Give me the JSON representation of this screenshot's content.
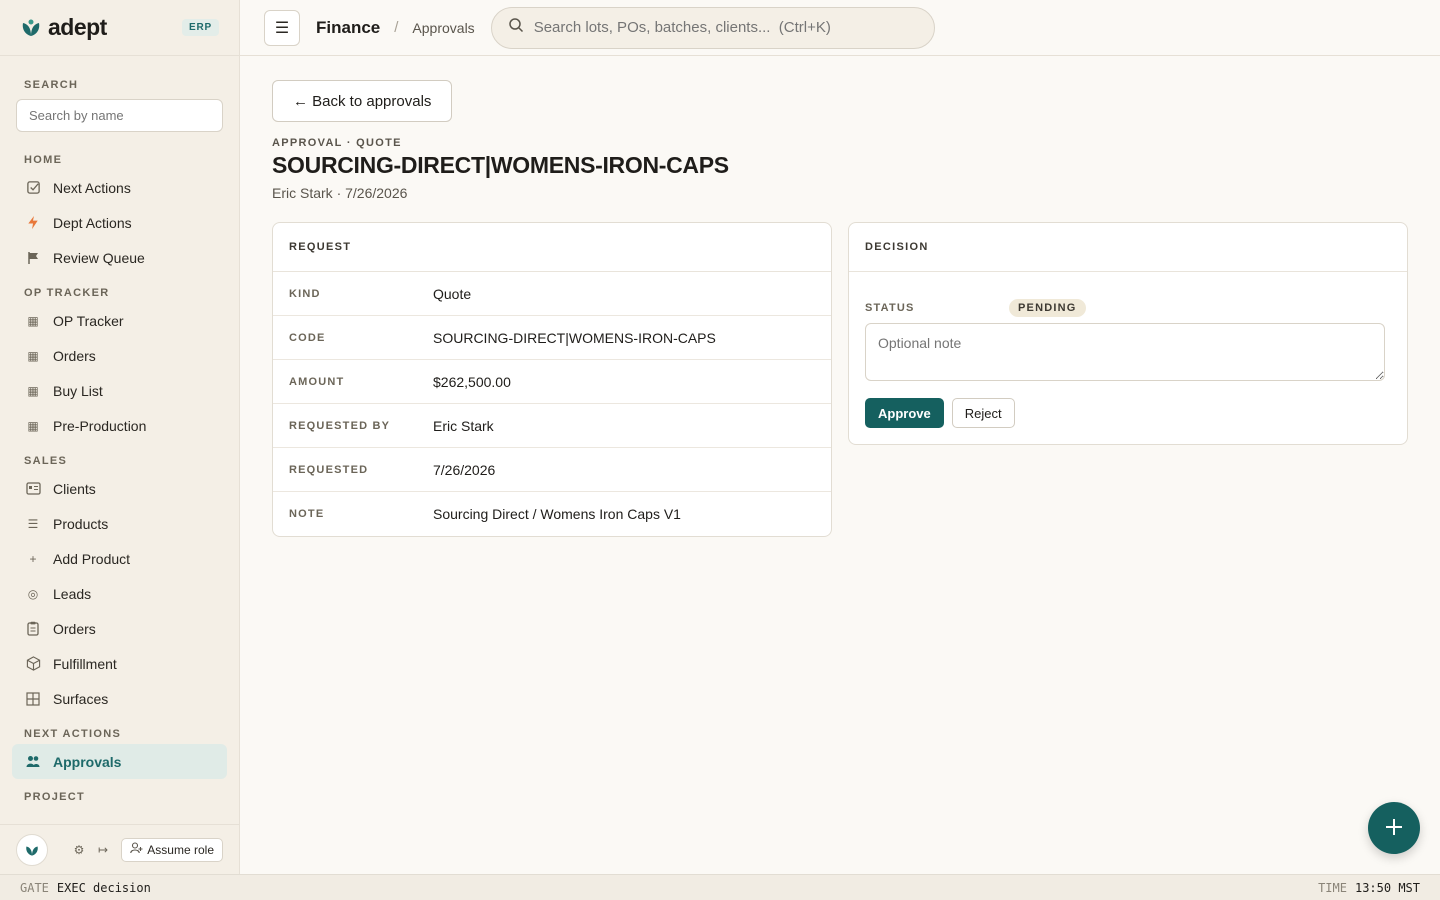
{
  "brand": {
    "name": "adept",
    "badge": "ERP"
  },
  "sidebar": {
    "search_label": "SEARCH",
    "search_placeholder": "Search by name",
    "groups": [
      {
        "label": "HOME",
        "items": [
          {
            "label": "Next Actions",
            "icon": "check-square-icon"
          },
          {
            "label": "Dept Actions",
            "icon": "bolt-icon"
          },
          {
            "label": "Review Queue",
            "icon": "flag-icon"
          }
        ]
      },
      {
        "label": "OP TRACKER",
        "items": [
          {
            "label": "OP Tracker",
            "icon": "grid-icon"
          },
          {
            "label": "Orders",
            "icon": "grid-icon"
          },
          {
            "label": "Buy List",
            "icon": "grid-icon"
          },
          {
            "label": "Pre-Production",
            "icon": "grid-icon"
          }
        ]
      },
      {
        "label": "SALES",
        "items": [
          {
            "label": "Clients",
            "icon": "id-card-icon"
          },
          {
            "label": "Products",
            "icon": "list-icon"
          },
          {
            "label": "Add Product",
            "icon": "plus-icon"
          },
          {
            "label": "Leads",
            "icon": "target-icon"
          },
          {
            "label": "Orders",
            "icon": "clipboard-icon"
          },
          {
            "label": "Fulfillment",
            "icon": "box-icon"
          },
          {
            "label": "Surfaces",
            "icon": "table-icon"
          }
        ]
      },
      {
        "label": "NEXT ACTIONS",
        "items": [
          {
            "label": "Approvals",
            "icon": "users-icon",
            "active": true
          }
        ]
      },
      {
        "label": "PROJECT",
        "items": []
      }
    ],
    "footer": {
      "assume_role": "Assume role"
    }
  },
  "topbar": {
    "breadcrumb_root": "Finance",
    "breadcrumb_sep": "/",
    "breadcrumb_page": "Approvals",
    "search_placeholder": "Search lots, POs, batches, clients...  (Ctrl+K)"
  },
  "page": {
    "back_label": "← Back to approvals",
    "eyebrow": "APPROVAL · QUOTE",
    "title": "SOURCING-DIRECT|WOMENS-IRON-CAPS",
    "subtitle": "Eric Stark · 7/26/2026"
  },
  "request": {
    "heading": "REQUEST",
    "rows": [
      {
        "key": "KIND",
        "value": "Quote"
      },
      {
        "key": "CODE",
        "value": "SOURCING-DIRECT|WOMENS-IRON-CAPS"
      },
      {
        "key": "AMOUNT",
        "value": "$262,500.00"
      },
      {
        "key": "REQUESTED BY",
        "value": "Eric Stark"
      },
      {
        "key": "REQUESTED",
        "value": "7/26/2026"
      },
      {
        "key": "NOTE",
        "value": "Sourcing Direct / Womens Iron Caps V1"
      }
    ]
  },
  "decision": {
    "heading": "DECISION",
    "status_key": "STATUS",
    "status_value": "PENDING",
    "note_placeholder": "Optional note",
    "approve_label": "Approve",
    "reject_label": "Reject"
  },
  "statusbar": {
    "gate_key": "GATE",
    "gate_value": "EXEC decision",
    "time_key": "TIME",
    "time_value": "13:50 MST"
  },
  "colors": {
    "accent": "#15605f",
    "sidebar_bg": "#f4efe6",
    "page_bg": "#fbf9f5"
  }
}
